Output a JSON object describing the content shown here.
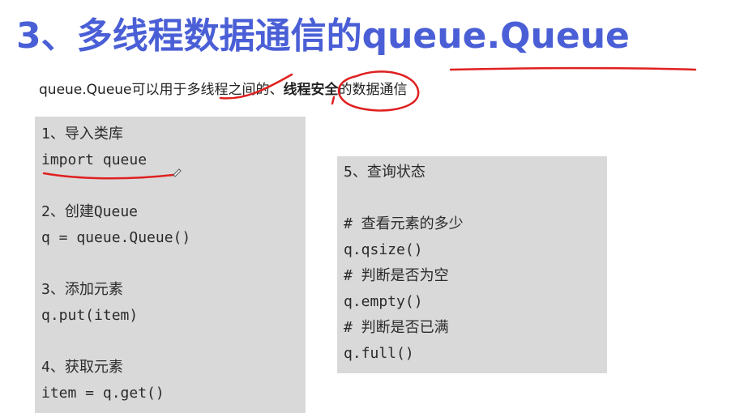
{
  "slide": {
    "title": "3、多线程数据通信的queue.Queue",
    "subtitle": {
      "part1": "queue.Queue可以用于多线程之间的、",
      "bold": "线程安全",
      "part2": "的数据通信"
    }
  },
  "left_box": {
    "step1_heading": "1、导入类库",
    "step1_code": "import queue",
    "step2_heading": "2、创建Queue",
    "step2_code": "q = queue.Queue()",
    "step3_heading": "3、添加元素",
    "step3_code": "q.put(item)",
    "step4_heading": "4、获取元素",
    "step4_code": "item = q.get()"
  },
  "right_box": {
    "heading": "5、查询状态",
    "comment1": "# 查看元素的多少",
    "code1": "q.qsize()",
    "comment2": "# 判断是否为空",
    "code2": "q.empty()",
    "comment3": "# 判断是否已满",
    "code3": "q.full()"
  },
  "colors": {
    "title": "#4a5fd6",
    "annotation": "#e02020",
    "code_box_bg": "#d9d9d9"
  }
}
